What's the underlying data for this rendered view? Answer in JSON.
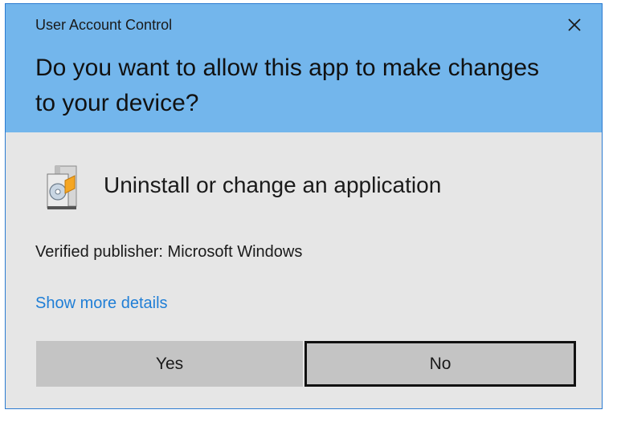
{
  "window": {
    "title": "User Account Control",
    "close_icon": "close-icon",
    "header_color": "#73b6ec",
    "border_color": "#2b7bd1"
  },
  "prompt": {
    "question": "Do you want to allow this app to make changes to your device?"
  },
  "app": {
    "icon": "program-installer-icon",
    "name": "Uninstall or change an application",
    "publisher": "Verified publisher: Microsoft Windows"
  },
  "links": {
    "show_more": "Show more details",
    "link_color": "#1f7ed6"
  },
  "buttons": {
    "yes": "Yes",
    "no": "No",
    "focused": "No"
  }
}
